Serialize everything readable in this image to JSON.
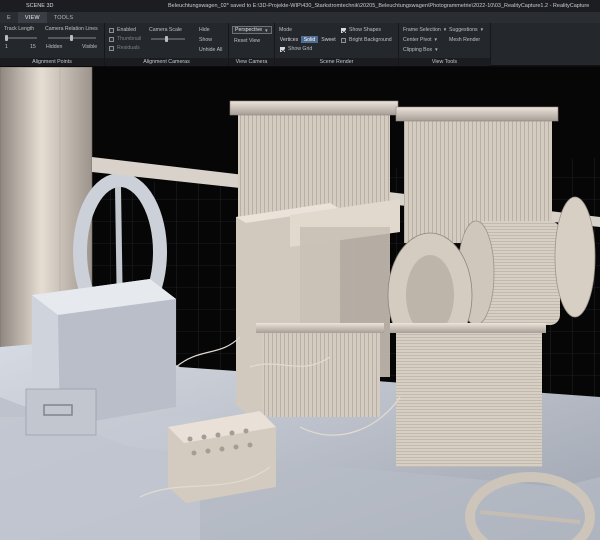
{
  "titlebar": {
    "app_tab": "SCENE 3D",
    "doc_title": "Beleuchtungswagen_02* saved to E:\\3D-Projekte-WIP\\430_Starkstromtechnik\\20205_Beleuchtungswagen\\Photogrammetrie\\2022-10\\03_RealityCapture1.2 - RealityCapture"
  },
  "menubar": {
    "tabs": [
      {
        "label": "E",
        "active": false
      },
      {
        "label": "VIEW",
        "active": true
      },
      {
        "label": "TOOLS",
        "active": false
      }
    ]
  },
  "ribbon": {
    "alignment_points": {
      "title": "Alignment Points",
      "track_length_label": "Track Length",
      "track_min": "1",
      "track_max": "15",
      "camera_lines_label": "Camera Relation Lines",
      "hidden_label": "Hidden",
      "visible_label": "Visible"
    },
    "alignment_cameras": {
      "title": "Alignment Cameras",
      "enabled_label": "Enabled",
      "thumbnail_label": "Thumbnail",
      "residuals_label": "Residuals",
      "camera_scale_label": "Camera Scale",
      "hide_label": "Hide",
      "show_label": "Show",
      "unhide_all_label": "Unhide All"
    },
    "view_camera": {
      "title": "View Camera",
      "projection_value": "Perspective",
      "reset_view_label": "Reset View"
    },
    "scene_render": {
      "title": "Scene Render",
      "mode_label": "Mode",
      "modes": [
        "Vertices",
        "Solid",
        "Sweet"
      ],
      "active_mode": "Solid",
      "show_grid_label": "Show Grid",
      "show_shapes_label": "Show Shapes",
      "bright_background_label": "Bright Background"
    },
    "view_tools": {
      "title": "View Tools",
      "frame_selection_label": "Frame Selection",
      "suggestions_label": "Suggestions",
      "center_pivot_label": "Center Pivot",
      "mesh_render_label": "Mesh Render",
      "clipping_box_label": "Clipping Box"
    }
  },
  "colors": {
    "ribbon_bg": "#24272b",
    "active_mode": "#4f6d93",
    "model_base": "#d9d0c6",
    "viewport_bg": "#060607",
    "grid_line": "#3a3f4a"
  },
  "icons": {
    "caret": "chevron-down-icon"
  }
}
